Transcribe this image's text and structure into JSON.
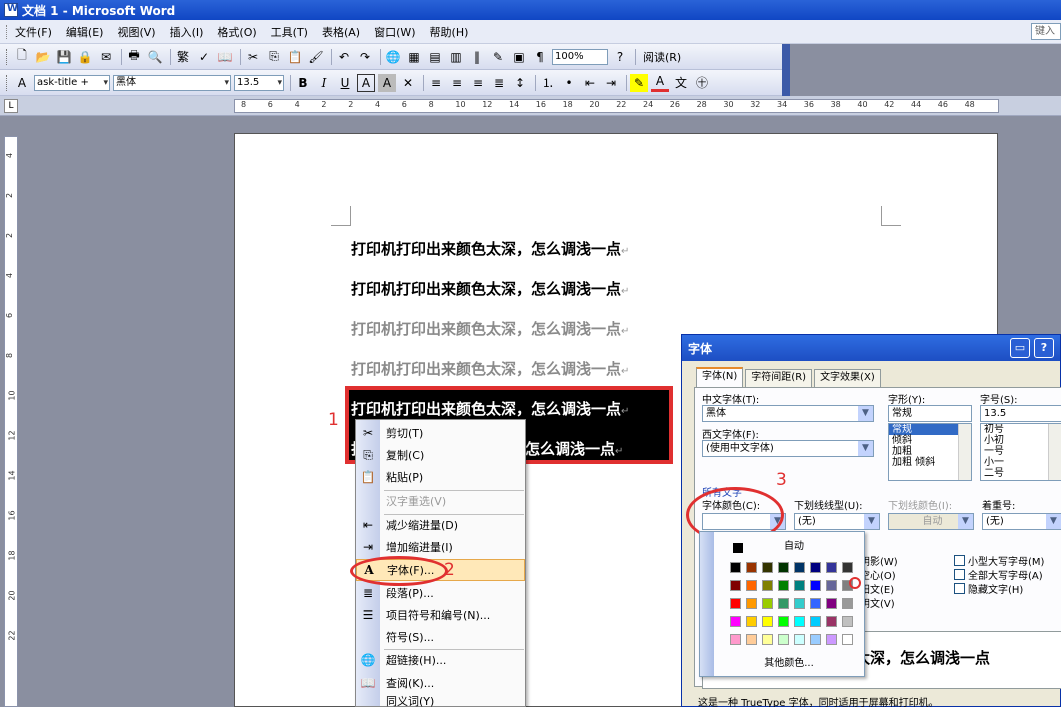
{
  "window": {
    "title": "文档 1 - Microsoft Word"
  },
  "menubar": {
    "items": [
      "文件(F)",
      "编辑(E)",
      "视图(V)",
      "插入(I)",
      "格式(O)",
      "工具(T)",
      "表格(A)",
      "窗口(W)",
      "帮助(H)"
    ],
    "help_search": "键入"
  },
  "toolbar_standard": {
    "zoom": "100%",
    "read_label": "阅读(R)",
    "icons": [
      "new-icon",
      "open-icon",
      "save-icon",
      "permission-icon",
      "email-icon",
      "print-icon",
      "print-preview-icon",
      "traditional-chinese-icon",
      "spelling-icon",
      "research-icon",
      "cut-icon",
      "copy-icon",
      "paste-icon",
      "format-painter-icon",
      "undo-icon",
      "redo-icon",
      "hyperlink-icon",
      "tables-borders-icon",
      "insert-table-icon",
      "insert-excel-icon",
      "columns-icon",
      "drawing-icon",
      "document-map-icon",
      "show-hide-icon",
      "help-icon"
    ]
  },
  "toolbar_formatting": {
    "style": "ask-title +",
    "font": "黑体",
    "size": "13.5",
    "bold": "B",
    "italic": "I",
    "underline": "U",
    "char_border": "A",
    "char_shade": "A",
    "icons": [
      "styles-icon",
      "align-left-icon",
      "center-icon",
      "align-right-icon",
      "justify-icon",
      "line-spacing-icon",
      "numbering-icon",
      "bullets-icon",
      "decrease-indent-icon",
      "increase-indent-icon",
      "highlight-icon",
      "font-color-icon",
      "phonetic-guide-icon",
      "enclose-characters-icon"
    ]
  },
  "ruler": {
    "corner": "L",
    "h_ticks": [
      "8",
      "6",
      "4",
      "2",
      "2",
      "4",
      "6",
      "8",
      "10",
      "12",
      "14",
      "16",
      "18",
      "20",
      "22",
      "24",
      "26",
      "28",
      "30",
      "32",
      "34",
      "36",
      "38",
      "40",
      "42",
      "44",
      "46",
      "48"
    ],
    "v_ticks": [
      "4",
      "2",
      "2",
      "4",
      "6",
      "8",
      "10",
      "12",
      "14",
      "16",
      "18",
      "20",
      "22"
    ]
  },
  "document": {
    "lines": [
      "打印机打印出来颜色太深，怎么调浅一点",
      "打印机打印出来颜色太深，怎么调浅一点",
      "打印机打印出来颜色太深，怎么调浅一点",
      "打印机打印出来颜色太深，怎么调浅一点",
      "打印机打印出来颜色太深，怎么调浅一点",
      "怎么调浅一点"
    ],
    "selected_line_partial": "打",
    "paragraph_mark": "↵"
  },
  "annotations": {
    "step1": "1",
    "step2": "2",
    "step3": "3"
  },
  "context_menu": {
    "items": [
      {
        "label": "剪切(T)",
        "icon": "cut-icon",
        "disabled": false
      },
      {
        "label": "复制(C)",
        "icon": "copy-icon",
        "disabled": false
      },
      {
        "label": "粘贴(P)",
        "icon": "paste-icon",
        "disabled": false
      },
      {
        "label": "汉字重选(V)",
        "icon": "",
        "disabled": true
      },
      {
        "label": "减少缩进量(D)",
        "icon": "decrease-indent-icon",
        "disabled": false
      },
      {
        "label": "增加缩进量(I)",
        "icon": "increase-indent-icon",
        "disabled": false
      },
      {
        "label": "字体(F)...",
        "icon": "font-icon",
        "disabled": false
      },
      {
        "label": "段落(P)...",
        "icon": "paragraph-icon",
        "disabled": false
      },
      {
        "label": "项目符号和编号(N)...",
        "icon": "bullets-numbering-icon",
        "disabled": false
      },
      {
        "label": "符号(S)...",
        "icon": "",
        "disabled": false
      },
      {
        "label": "超链接(H)...",
        "icon": "hyperlink-icon",
        "disabled": false
      },
      {
        "label": "查阅(K)...",
        "icon": "lookup-icon",
        "disabled": false
      },
      {
        "label": "同义词(Y)",
        "icon": "",
        "disabled": false
      }
    ]
  },
  "font_dialog": {
    "title": "字体",
    "tabs": [
      "字体(N)",
      "字符间距(R)",
      "文字效果(X)"
    ],
    "chinese_font_label": "中文字体(T):",
    "chinese_font_value": "黑体",
    "western_font_label": "西文字体(F):",
    "western_font_value": "(使用中文字体)",
    "style_label": "字形(Y):",
    "style_value": "常规",
    "style_options": [
      "常规",
      "倾斜",
      "加粗",
      "加粗 倾斜"
    ],
    "size_label": "字号(S):",
    "size_value": "13.5",
    "size_options": [
      "初号",
      "小初",
      "一号",
      "小一",
      "二号"
    ],
    "all_text_label": "所有文字",
    "font_color_label": "字体颜色(C):",
    "underline_style_label": "下划线线型(U):",
    "underline_style_value": "(无)",
    "underline_color_label": "下划线颜色(I):",
    "underline_color_value": "自动",
    "emphasis_label": "着重号:",
    "emphasis_value": "(无)",
    "effects_left": [
      "阴影(W)",
      "空心(O)",
      "阳文(E)",
      "阴文(V)"
    ],
    "effects_right": [
      "小型大写字母(M)",
      "全部大写字母(A)",
      "隐藏文字(H)"
    ],
    "preview_text": "色太深，怎么调浅一点",
    "footnote": "这是一种 TrueType 字体，同时适用于屏幕和打印机。"
  },
  "color_palette": {
    "auto_label": "自动",
    "more_label": "其他颜色...",
    "rows": [
      [
        "#000000",
        "#993300",
        "#333300",
        "#003300",
        "#003366",
        "#000080",
        "#333399",
        "#333333"
      ],
      [
        "#800000",
        "#FF6600",
        "#808000",
        "#008000",
        "#008080",
        "#0000FF",
        "#666699",
        "#808080"
      ],
      [
        "#FF0000",
        "#FF9900",
        "#99CC00",
        "#339966",
        "#33CCCC",
        "#3366FF",
        "#800080",
        "#999999"
      ],
      [
        "#FF00FF",
        "#FFCC00",
        "#FFFF00",
        "#00FF00",
        "#00FFFF",
        "#00CCFF",
        "#993366",
        "#C0C0C0"
      ],
      [
        "#FF99CC",
        "#FFCC99",
        "#FFFF99",
        "#CCFFCC",
        "#CCFFFF",
        "#99CCFF",
        "#CC99FF",
        "#FFFFFF"
      ]
    ]
  }
}
